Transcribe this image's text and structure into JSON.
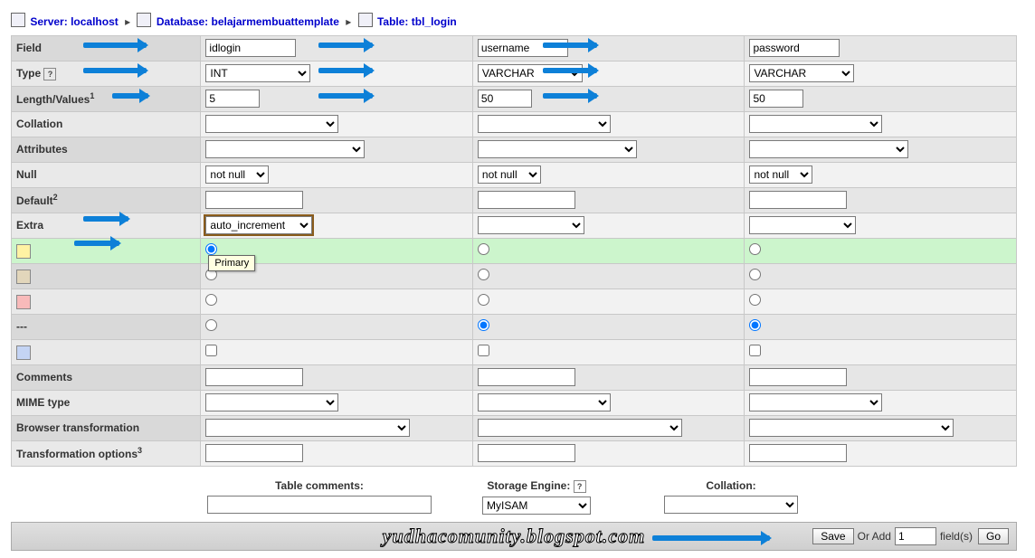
{
  "breadcrumb": {
    "server_label": "Server:",
    "server_value": "localhost",
    "database_label": "Database:",
    "database_value": "belajarmembuattemplate",
    "table_label": "Table:",
    "table_value": "tbl_login"
  },
  "rows": {
    "field": "Field",
    "type": "Type",
    "length": "Length/Values",
    "collation": "Collation",
    "attributes": "Attributes",
    "null_label": "Null",
    "default_label": "Default",
    "extra": "Extra",
    "dashes": "---",
    "comments": "Comments",
    "mime": "MIME type",
    "browser_trans": "Browser transformation",
    "trans_opts": "Transformation options"
  },
  "columns": [
    {
      "field": "idlogin",
      "type": "INT",
      "length": "5",
      "null": "not null",
      "extra": "auto_increment",
      "key_radio": "primary",
      "no_index": false
    },
    {
      "field": "username",
      "type": "VARCHAR",
      "length": "50",
      "null": "not null",
      "extra": "",
      "key_radio": "none",
      "no_index": true
    },
    {
      "field": "password",
      "type": "VARCHAR",
      "length": "50",
      "null": "not null",
      "extra": "",
      "key_radio": "none",
      "no_index": true
    }
  ],
  "tooltip_primary": "Primary",
  "footer": {
    "table_comments": "Table comments:",
    "storage_engine": "Storage Engine:",
    "storage_value": "MyISAM",
    "collation": "Collation:"
  },
  "savebar": {
    "watermark": "yudhacomunity.blogspot.com",
    "save": "Save",
    "or_add": "Or Add",
    "add_count": "1",
    "fields": "field(s)",
    "go": "Go"
  },
  "sup1": "1",
  "sup2": "2",
  "sup3": "3",
  "help_q": "?"
}
